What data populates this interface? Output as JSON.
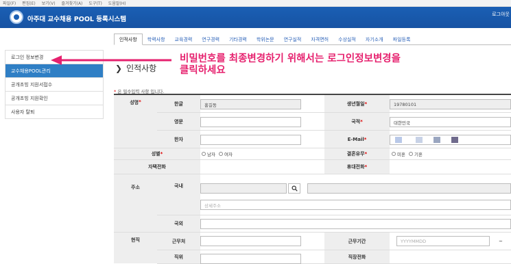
{
  "menubar": [
    "파일(F)",
    "편집(E)",
    "보기(V)",
    "즐겨찾기(A)",
    "도구(T)",
    "도움말(H)"
  ],
  "header": {
    "title": "아주대 교수채용 POOL 등록시스템",
    "login": "로그아웃"
  },
  "tabs": [
    "인적사항",
    "학력사항",
    "교육경력",
    "연구경력",
    "기타경력",
    "학위논문",
    "연구실적",
    "자격면허",
    "수상실적",
    "자기소개",
    "파일등록"
  ],
  "sidebar": [
    "로그인 정보변경",
    "교수채용POOL관리",
    "공개초빙 지원서접수",
    "공개초빙 지원확인",
    "사용자 탈퇴"
  ],
  "annotation": {
    "line1": "비밀번호를 최종변경하기 위해서는 로그인정보변경을",
    "line2": "클릭하세요"
  },
  "page_title": "인적사항",
  "required_note": {
    "star": "*",
    "text": "은 필수입력 사항 입니다."
  },
  "form": {
    "name_label": "성명",
    "korean_label": "한글",
    "korean_value": "홍길동",
    "english_label": "영문",
    "hanja_label": "한자",
    "birth_label": "생년월일",
    "birth_value": "19780101",
    "nation_label": "국적",
    "nation_value": "대한민국",
    "email_label": "E-Mail",
    "gender_label": "성별",
    "gender_male": "남자",
    "gender_female": "여자",
    "married_label": "결혼유무",
    "married_no": "미혼",
    "married_yes": "기혼",
    "phone_label": "자택전화",
    "mobile_label": "휴대전화",
    "address_label": "주소",
    "domestic_label": "국내",
    "detail_placeholder": "상세주소",
    "overseas_label": "국외",
    "current_label": "현직",
    "workplace_label": "근무처",
    "period_label": "근무기간",
    "period_placeholder": "YYYYMMDD",
    "period_sep": "~",
    "position_label": "직위",
    "work_phone_label": "직장전화",
    "star": "*"
  },
  "colors": {
    "header": "#1a5fb4",
    "sidebar_active": "#2f7fc5",
    "annotation": "#e6216e",
    "email_masks": [
      "#b9c9e8",
      "#c8d2e6",
      "#9aa6c0",
      "#6f6a8c"
    ]
  }
}
